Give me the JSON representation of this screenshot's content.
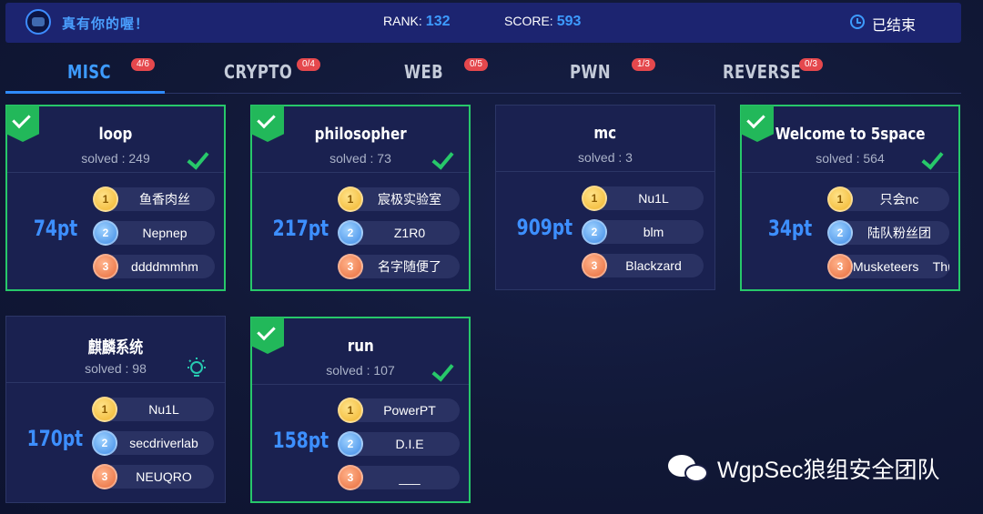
{
  "header": {
    "team_name": "真有你的喔！",
    "rank_label": "RANK:",
    "rank_value": "132",
    "score_label": "SCORE:",
    "score_value": "593",
    "status": "已结束",
    "icons": [
      "team-logo-icon",
      "clock-icon"
    ]
  },
  "tabs": [
    {
      "label": "MISC",
      "badge": "4/6",
      "active": true
    },
    {
      "label": "CRYPTO",
      "badge": "0/4"
    },
    {
      "label": "WEB",
      "badge": "0/5"
    },
    {
      "label": "PWN",
      "badge": "1/3"
    },
    {
      "label": "REVERSE",
      "badge": "0/3"
    }
  ],
  "challenges": [
    {
      "title": "loop",
      "solved_label": "solved : 249",
      "points": "74pt",
      "state": "solved",
      "solvers": [
        "鱼香肉丝",
        "Nepnep",
        "ddddmmhm"
      ]
    },
    {
      "title": "philosopher",
      "solved_label": "solved : 73",
      "points": "217pt",
      "state": "solved",
      "solvers": [
        "宸极实验室",
        "Z1R0",
        "名字随便了"
      ]
    },
    {
      "title": "mc",
      "solved_label": "solved : 3",
      "points": "909pt",
      "state": "unsolved",
      "solvers": [
        "Nu1L",
        "blm",
        "Blackzard"
      ]
    },
    {
      "title": "Welcome to 5space",
      "solved_label": "solved : 564",
      "points": "34pt",
      "state": "solved",
      "solvers": [
        "只会nc",
        "陆队粉丝团",
        "Musketeers    Thr"
      ]
    },
    {
      "title": "麒麟系统",
      "solved_label": "solved : 98",
      "points": "170pt",
      "state": "hint",
      "solvers": [
        "Nu1L",
        "secdriverlab",
        "NEUQRO"
      ]
    },
    {
      "title": "run",
      "solved_label": "solved : 107",
      "points": "158pt",
      "state": "solved",
      "solvers": [
        "PowerPT",
        "D.I.E",
        "___"
      ]
    }
  ],
  "medal_ranks": [
    "1",
    "2",
    "3"
  ],
  "colors": {
    "accent": "#3d9bff",
    "solved_border": "#27c86a",
    "badge": "#e5484d"
  },
  "watermark": {
    "text": "WgpSec狼组安全团队",
    "icon": "wechat-icon"
  }
}
